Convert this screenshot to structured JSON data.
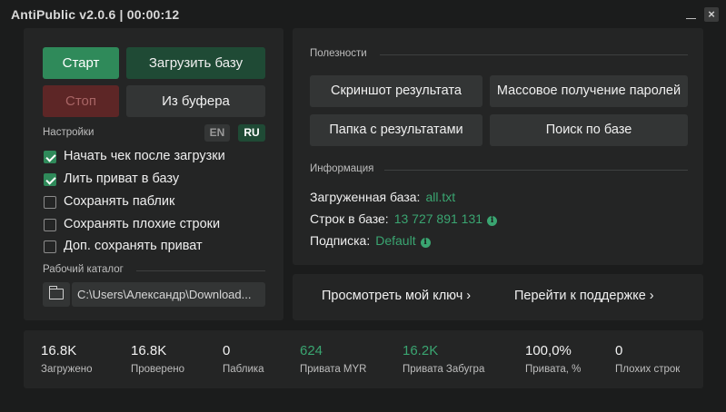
{
  "window": {
    "title": "AntiPublic v2.0.6 | 00:00:12",
    "minimize_label": "",
    "close_label": "×"
  },
  "controls": {
    "start": "Старт",
    "load_base": "Загрузить базу",
    "stop": "Стоп",
    "from_buffer": "Из буфера"
  },
  "settings": {
    "label": "Настройки",
    "lang_en": "EN",
    "lang_ru": "RU",
    "selected_lang": "RU",
    "options": [
      {
        "label": "Начать чек после загрузки",
        "checked": true
      },
      {
        "label": "Лить приват в базу",
        "checked": true
      },
      {
        "label": "Сохранять паблик",
        "checked": false
      },
      {
        "label": "Сохранять плохие строки",
        "checked": false
      },
      {
        "label": "Доп. сохранять приват",
        "checked": false
      }
    ]
  },
  "workdir": {
    "label": "Рабочий каталог",
    "path": "C:\\Users\\Александр\\Download...",
    "icon": "folder-icon"
  },
  "utilities": {
    "label": "Полезности",
    "buttons": [
      "Скриншот результата",
      "Массовое получение паролей",
      "Папка с результатами",
      "Поиск по базе"
    ]
  },
  "info": {
    "label": "Информация",
    "rows": [
      {
        "key": "Загруженная база:",
        "value": "all.txt",
        "has_icon": false
      },
      {
        "key": "Строк в базе:",
        "value": "13 727 891 131",
        "has_icon": true
      },
      {
        "key": "Подписка:",
        "value": "Default",
        "has_icon": true
      }
    ],
    "icon_glyph": "i"
  },
  "links": {
    "view_key": "Просмотреть мой ключ ›",
    "support": "Перейти к поддержке ›"
  },
  "stats": [
    {
      "value": "16.8K",
      "label": "Загружено",
      "accent": false
    },
    {
      "value": "16.8K",
      "label": "Проверено",
      "accent": false
    },
    {
      "value": "0",
      "label": "Паблика",
      "accent": false
    },
    {
      "value": "624",
      "label": "Привата MYR",
      "accent": true
    },
    {
      "value": "16.2K",
      "label": "Привата Забугра",
      "accent": true
    },
    {
      "value": "100,0%",
      "label": "Привата, %",
      "accent": false
    },
    {
      "value": "0",
      "label": "Плохих строк",
      "accent": false
    }
  ],
  "colors": {
    "background": "#1b1c1c",
    "panel": "#242525",
    "accent_green": "#2f8a5a",
    "accent_text": "#3aa571",
    "stop_red": "#5d2626"
  }
}
